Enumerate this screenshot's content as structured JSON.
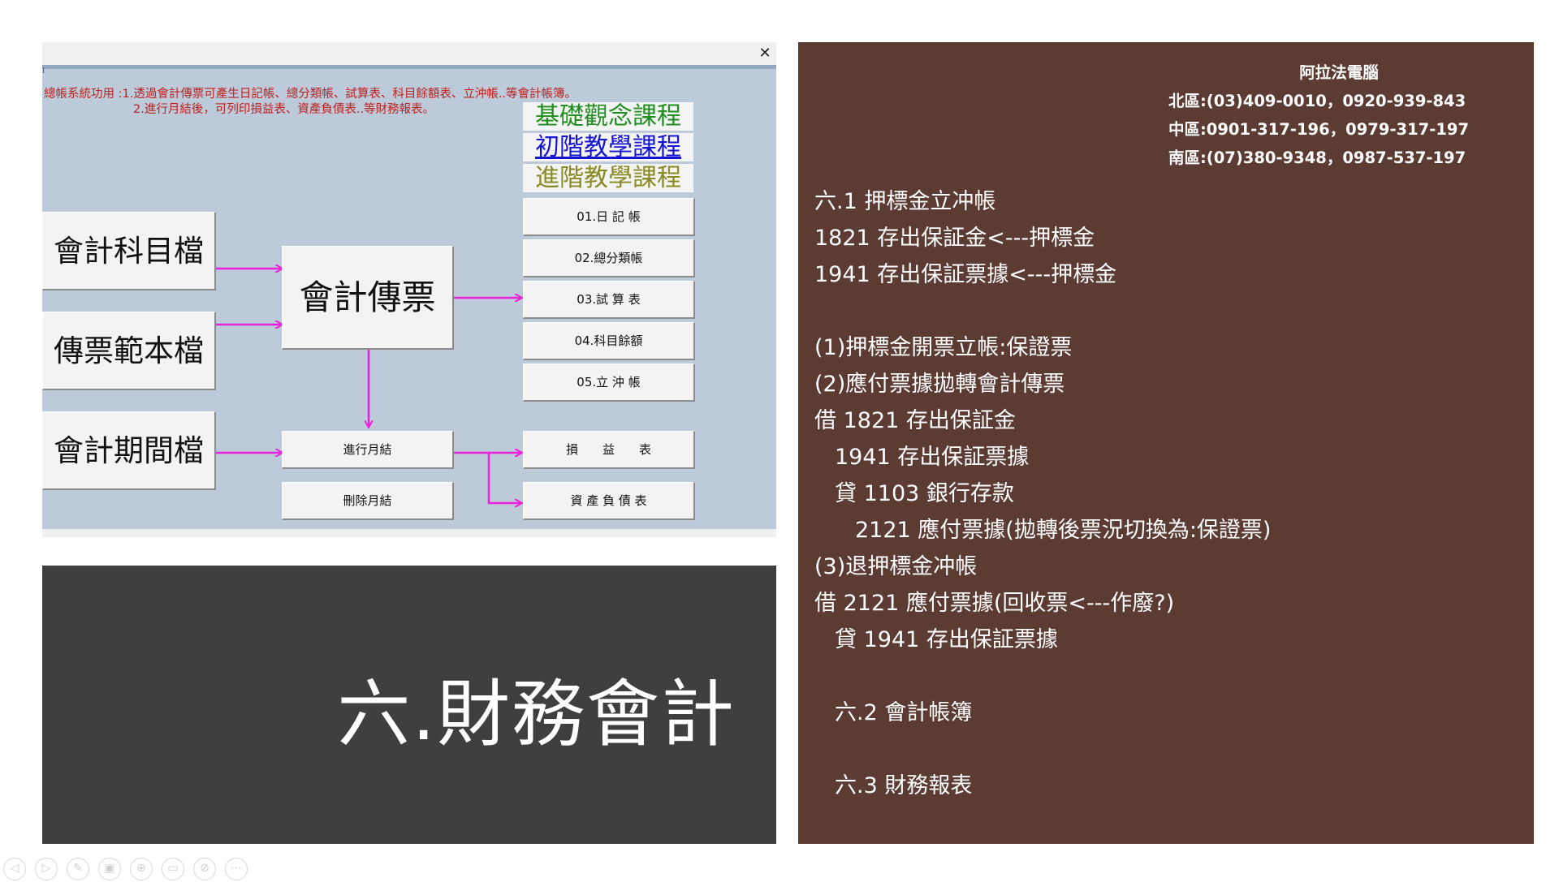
{
  "app": {
    "close_icon": "close-icon",
    "desc_line1": "總帳系統功用 :1.透過會計傳票可產生日記帳、總分類帳、試算表、科目餘額表、立沖帳..等會計帳簿。",
    "desc_line2": "2.進行月結後，可列印損益表、資產負債表..等財務報表。",
    "courses": [
      {
        "label": "基礎觀念課程",
        "color": "#1e8f1e"
      },
      {
        "label": "初階教學課程",
        "color": "#1414d2"
      },
      {
        "label": "進階教學課程",
        "color": "#8a8a22"
      }
    ],
    "inputs": [
      "會計科目檔",
      "傳票範本檔",
      "會計期間檔"
    ],
    "voucher": "會計傳票",
    "reports": [
      "01.日 記 帳",
      "02.總分類帳",
      "03.試 算 表",
      "04.科目餘額",
      "05.立 沖 帳"
    ],
    "month_close": "進行月結",
    "delete_close": "刪除月結",
    "income_statement": "損　　益　　表",
    "balance_sheet": "資 產 負 債 表",
    "arrow_color": "#ee22dd"
  },
  "slide_title": "六.財務會計",
  "contact": {
    "name": "阿拉法電腦",
    "north": "北區:(03)409-0010，0920-939-843",
    "central": "中區:0901-317-196，0979-317-197",
    "south": "南區:(07)380-9348，0987-537-197"
  },
  "notes": [
    "六.1 押標金立冲帳",
    "1821 存出保証金<---押標金",
    "1941 存出保証票據<---押標金",
    "(1)押標金開票立帳:保證票",
    "(2)應付票據拋轉會計傳票",
    "借 1821 存出保証金",
    "1941 存出保証票據",
    "貸 1103 銀行存款",
    "2121 應付票據(拋轉後票況切換為:保證票)",
    "(3)退押標金冲帳",
    "借 2121 應付票據(回收票<---作廢?)",
    "貸 1941 存出保証票據",
    "六.2 會計帳簿",
    "六.3 財務報表"
  ],
  "colors": {
    "right_panel": "#5c3b33",
    "title_block": "#3f3f3f",
    "app_bg": "#bccad9"
  },
  "toolbar_icons": [
    "prev-icon",
    "next-icon",
    "pen-icon",
    "slides-icon",
    "zoom-icon",
    "subtitle-icon",
    "camera-off-icon",
    "more-icon"
  ],
  "toolbar_glyphs": [
    "◁",
    "▷",
    "✎",
    "▣",
    "⊕",
    "▭",
    "⊘",
    "⋯"
  ]
}
